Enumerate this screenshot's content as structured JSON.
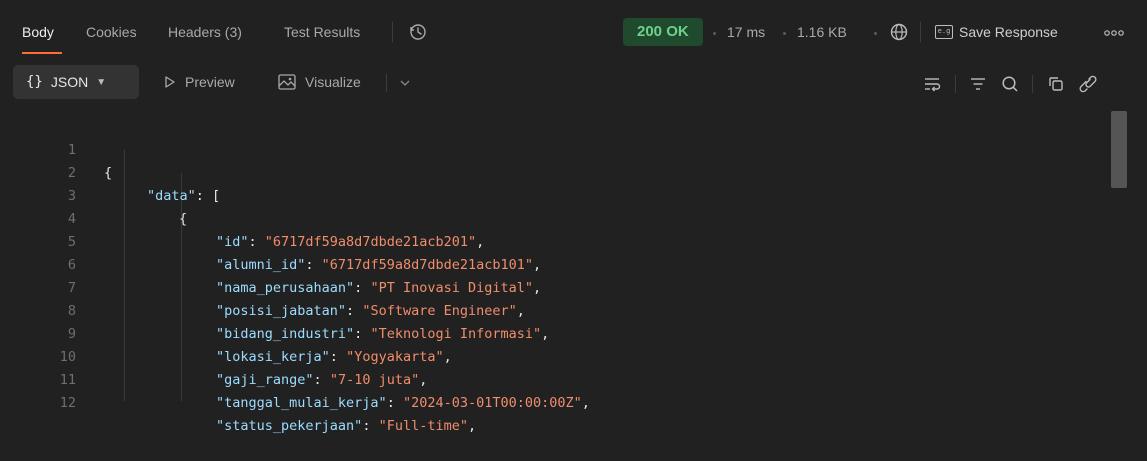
{
  "tabs": {
    "body": "Body",
    "cookies": "Cookies",
    "headers": "Headers (3)",
    "test_results": "Test Results"
  },
  "response_meta": {
    "status": "200 OK",
    "time": "17 ms",
    "size": "1.16 KB",
    "save_label": "Save Response",
    "save_icon_text": "e.g"
  },
  "toolbar": {
    "format_label": "JSON",
    "preview_label": "Preview",
    "visualize_label": "Visualize"
  },
  "icons": {
    "history": "history-icon",
    "globe": "globe-icon",
    "more": "more-icon",
    "wrap": "wrap-lines-icon",
    "filter": "filter-icon",
    "search": "search-icon",
    "copy": "copy-icon",
    "link": "link-icon"
  },
  "colors": {
    "accent": "#ff6c37",
    "status_ok": "#6fd08c",
    "key": "#9cdcfe",
    "string": "#f08d6b"
  },
  "code": [
    {
      "n": "1",
      "indent": 0,
      "open": "{"
    },
    {
      "n": "2",
      "indent": 1,
      "key": "\"data\"",
      "open": "["
    },
    {
      "n": "3",
      "indent": 2,
      "open": "{"
    },
    {
      "n": "4",
      "indent": 3,
      "key": "\"id\"",
      "value": "\"6717df59a8d7dbde21acb201\""
    },
    {
      "n": "5",
      "indent": 3,
      "key": "\"alumni_id\"",
      "value": "\"6717df59a8d7dbde21acb101\""
    },
    {
      "n": "6",
      "indent": 3,
      "key": "\"nama_perusahaan\"",
      "value": "\"PT Inovasi Digital\""
    },
    {
      "n": "7",
      "indent": 3,
      "key": "\"posisi_jabatan\"",
      "value": "\"Software Engineer\""
    },
    {
      "n": "8",
      "indent": 3,
      "key": "\"bidang_industri\"",
      "value": "\"Teknologi Informasi\""
    },
    {
      "n": "9",
      "indent": 3,
      "key": "\"lokasi_kerja\"",
      "value": "\"Yogyakarta\""
    },
    {
      "n": "10",
      "indent": 3,
      "key": "\"gaji_range\"",
      "value": "\"7-10 juta\""
    },
    {
      "n": "11",
      "indent": 3,
      "key": "\"tanggal_mulai_kerja\"",
      "value": "\"2024-03-01T00:00:00Z\""
    },
    {
      "n": "12",
      "indent": 3,
      "key": "\"status_pekerjaan\"",
      "value": "\"Full-time\""
    }
  ]
}
